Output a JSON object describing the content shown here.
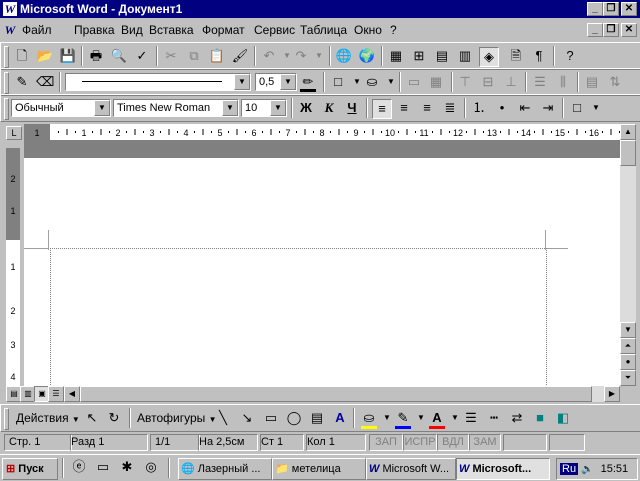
{
  "window": {
    "title": "Microsoft Word - Документ1",
    "app_icon": "W"
  },
  "menu": [
    "Файл",
    "Правка",
    "Вид",
    "Вставка",
    "Формат",
    "Сервис",
    "Таблица",
    "Окно",
    "?"
  ],
  "formatting": {
    "style": "Обычный",
    "font": "Times New Roman",
    "size": "10",
    "bold": "Ж",
    "italic": "К",
    "underline": "Ч"
  },
  "drawing_line": {
    "line_width": "0,5"
  },
  "drawing": {
    "actions": "Действия",
    "autoshapes": "Автофигуры"
  },
  "ruler": {
    "ticks": [
      "1",
      "1",
      "2",
      "3",
      "4",
      "5",
      "6",
      "7",
      "8",
      "9",
      "10",
      "11",
      "12",
      "13",
      "14",
      "15",
      "16"
    ]
  },
  "vruler": {
    "ticks": [
      "2",
      "1",
      "1",
      "2",
      "3",
      "4"
    ]
  },
  "status": {
    "page": "Стр. 1",
    "section": "Разд 1",
    "pages": "1/1",
    "at": "На 2,5см",
    "line": "Ст 1",
    "col": "Кол 1",
    "rec": "ЗАП",
    "trk": "ИСПР",
    "ext": "ВДЛ",
    "ovr": "ЗАМ"
  },
  "taskbar": {
    "start": "Пуск",
    "tasks": [
      "Лазерный ...",
      "метелица",
      "Microsoft W...",
      "Microsoft..."
    ],
    "lang": "Ru",
    "time": "15:51"
  },
  "colors": {
    "titlebar": "#000080",
    "face": "#c0c0c0",
    "highlight": "#ffff00",
    "font_color": "#ff0000",
    "line_color": "#0000ff"
  }
}
